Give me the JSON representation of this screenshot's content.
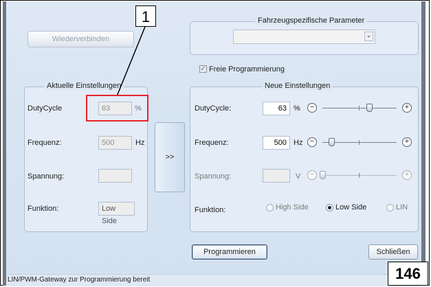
{
  "reconnect_button": "Wiederverbinden",
  "vehicle_params": {
    "legend": "Fahrzeugspezifische Parameter",
    "dropdown_value": ""
  },
  "free_programming": {
    "label": "Freie Programmierung",
    "checked": true
  },
  "current_settings": {
    "legend": "Aktuelle Einstellungen",
    "duty_label": "DutyCycle",
    "duty_value": "63",
    "duty_unit": "%",
    "freq_label": "Frequenz:",
    "freq_value": "500",
    "freq_unit": "Hz",
    "voltage_label": "Spannung:",
    "voltage_value": "",
    "function_label": "Funktion:",
    "function_value": "Low Side"
  },
  "transfer_button": ">>",
  "new_settings": {
    "legend": "Neue Einstellungen",
    "duty_label": "DutyCycle:",
    "duty_value": "63",
    "duty_unit": "%",
    "freq_label": "Frequenz:",
    "freq_value": "500",
    "freq_unit": "Hz",
    "voltage_label": "Spannung:",
    "voltage_value": "",
    "voltage_unit": "V",
    "function_label": "Funktion:",
    "radio_high": "High Side",
    "radio_low": "Low Side",
    "radio_lin": "LIN",
    "selected_function": "Low Side",
    "duty_slider_fraction": 0.63,
    "freq_slider_fraction": 0.12,
    "voltage_slider_fraction": 0.0
  },
  "program_button": "Programmieren",
  "close_button": "Schließen",
  "status_text": "LIN/PWM-Gateway zur Programmierung bereit",
  "callout_number": "1",
  "page_number": "146",
  "icons": {
    "dropdown": "chevron-down-icon",
    "minus": "minus-circle-icon",
    "plus": "plus-circle-icon",
    "checkbox": "checkmark-icon"
  }
}
